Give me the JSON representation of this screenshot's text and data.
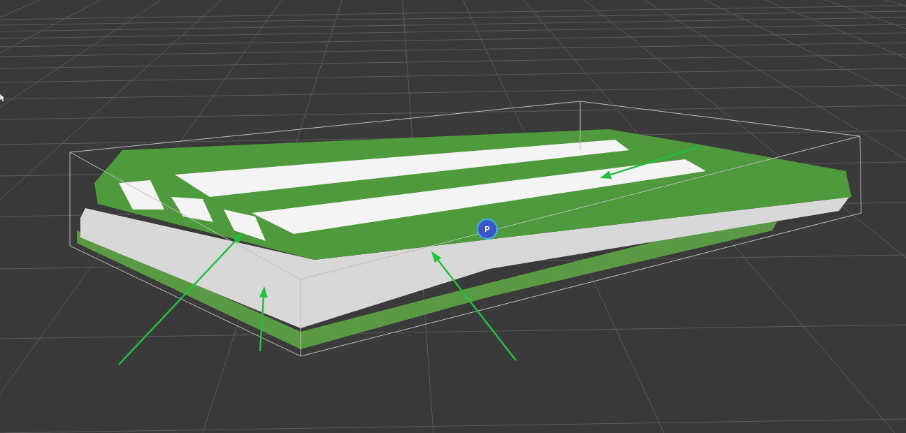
{
  "viewport": {
    "pivot_marker": {
      "label": "P"
    }
  }
}
